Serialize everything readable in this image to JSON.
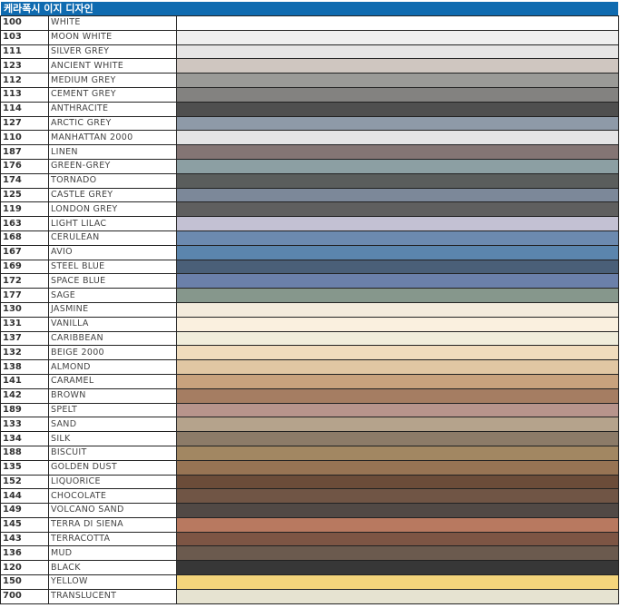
{
  "title": "케라폭시 이지 디자인",
  "rows": [
    {
      "code": "100",
      "name": "WHITE",
      "color": "#ffffff"
    },
    {
      "code": "103",
      "name": "MOON WHITE",
      "color": "#efefef"
    },
    {
      "code": "111",
      "name": "SILVER GREY",
      "color": "#e6e5e5"
    },
    {
      "code": "123",
      "name": "ANCIENT WHITE",
      "color": "#cfc6c0"
    },
    {
      "code": "112",
      "name": "MEDIUM GREY",
      "color": "#9a9a97"
    },
    {
      "code": "113",
      "name": "CEMENT GREY",
      "color": "#838280"
    },
    {
      "code": "114",
      "name": "ANTHRACITE",
      "color": "#4f4f4f"
    },
    {
      "code": "127",
      "name": "ARCTIC GREY",
      "color": "#8e9aa8"
    },
    {
      "code": "110",
      "name": "MANHATTAN 2000",
      "color": "#e4e4e5"
    },
    {
      "code": "187",
      "name": "LINEN",
      "color": "#847574"
    },
    {
      "code": "176",
      "name": "GREEN-GREY",
      "color": "#8c9fa3"
    },
    {
      "code": "174",
      "name": "TORNADO",
      "color": "#5a5d5c"
    },
    {
      "code": "125",
      "name": "CASTLE GREY",
      "color": "#7c8899"
    },
    {
      "code": "119",
      "name": "LONDON GREY",
      "color": "#5f5f5f"
    },
    {
      "code": "163",
      "name": "LIGHT LILAC",
      "color": "#c3c1d3"
    },
    {
      "code": "168",
      "name": "CERULEAN",
      "color": "#6c8aaf"
    },
    {
      "code": "167",
      "name": "AVIO",
      "color": "#5b85ad"
    },
    {
      "code": "169",
      "name": "STEEL BLUE",
      "color": "#4a5f78"
    },
    {
      "code": "172",
      "name": "SPACE BLUE",
      "color": "#6b80aa"
    },
    {
      "code": "177",
      "name": "SAGE",
      "color": "#86978c"
    },
    {
      "code": "130",
      "name": "JASMINE",
      "color": "#f3ebdc"
    },
    {
      "code": "131",
      "name": "VANILLA",
      "color": "#faf0df"
    },
    {
      "code": "137",
      "name": "CARIBBEAN",
      "color": "#f0eddb"
    },
    {
      "code": "132",
      "name": "BEIGE 2000",
      "color": "#f0dcbc"
    },
    {
      "code": "138",
      "name": "ALMOND",
      "color": "#e1c7a3"
    },
    {
      "code": "141",
      "name": "CARAMEL",
      "color": "#c8a27d"
    },
    {
      "code": "142",
      "name": "BROWN",
      "color": "#a57d62"
    },
    {
      "code": "189",
      "name": "SPELT",
      "color": "#b7948c"
    },
    {
      "code": "133",
      "name": "SAND",
      "color": "#b5a38c"
    },
    {
      "code": "134",
      "name": "SILK",
      "color": "#8c7b68"
    },
    {
      "code": "188",
      "name": "BISCUIT",
      "color": "#a28762"
    },
    {
      "code": "135",
      "name": "GOLDEN DUST",
      "color": "#977454"
    },
    {
      "code": "152",
      "name": "LIQUORICE",
      "color": "#6b4c39"
    },
    {
      "code": "144",
      "name": "CHOCOLATE",
      "color": "#705545"
    },
    {
      "code": "149",
      "name": "VOLCANO SAND",
      "color": "#514945"
    },
    {
      "code": "145",
      "name": "TERRA DI SIENA",
      "color": "#b87960"
    },
    {
      "code": "143",
      "name": "TERRACOTTA",
      "color": "#7d5544"
    },
    {
      "code": "136",
      "name": "MUD",
      "color": "#6b5a4e"
    },
    {
      "code": "120",
      "name": "BLACK",
      "color": "#373737"
    },
    {
      "code": "150",
      "name": "YELLOW",
      "color": "#f4d57c"
    },
    {
      "code": "700",
      "name": "TRANSLUCENT",
      "color": "#e6e3d1"
    }
  ]
}
